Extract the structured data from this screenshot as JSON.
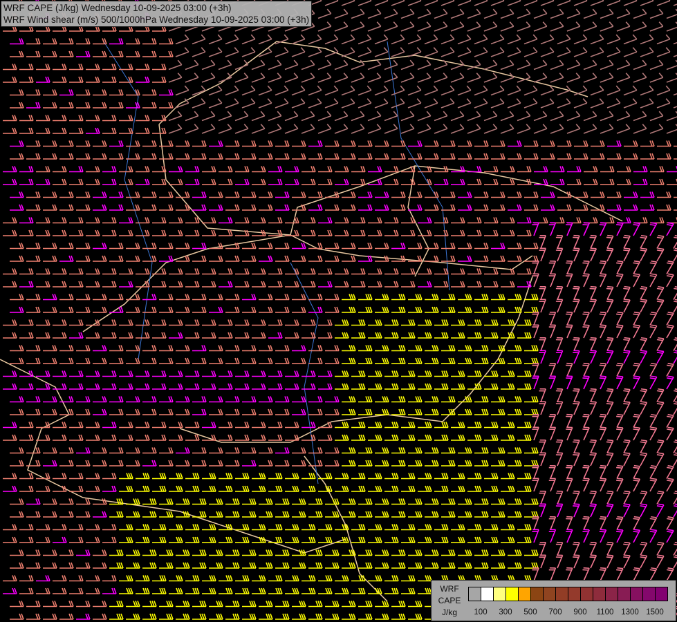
{
  "title": {
    "line1": "WRF CAPE (J/kg) Wednesday 10-09-2025 03:00 (+3h)",
    "line2": "WRF Wind shear (m/s) 500/1000hPa Wednesday 10-09-2025 03:00 (+3h)"
  },
  "legend": {
    "label_line1": "WRF",
    "label_line2": "CAPE",
    "label_line3": "J/kg",
    "colors": [
      "#a6a6a6",
      "#ffffff",
      "#ffff80",
      "#ffff00",
      "#ffa500",
      "#8b4513",
      "#8f4420",
      "#923d26",
      "#943a2c",
      "#913232",
      "#8e2c3c",
      "#8b2448",
      "#881c54",
      "#861060",
      "#84086c",
      "#820070"
    ],
    "ticks": [
      "100",
      "300",
      "500",
      "700",
      "900",
      "1100",
      "1300",
      "1500"
    ]
  },
  "barb_colors": {
    "north": "#b07878",
    "west": "#f08070",
    "strong": "#ff00ff",
    "cape": "#ffff00",
    "east": "#f07890"
  },
  "border_color": "#e8c8a0",
  "river_color": "#3c78d8"
}
